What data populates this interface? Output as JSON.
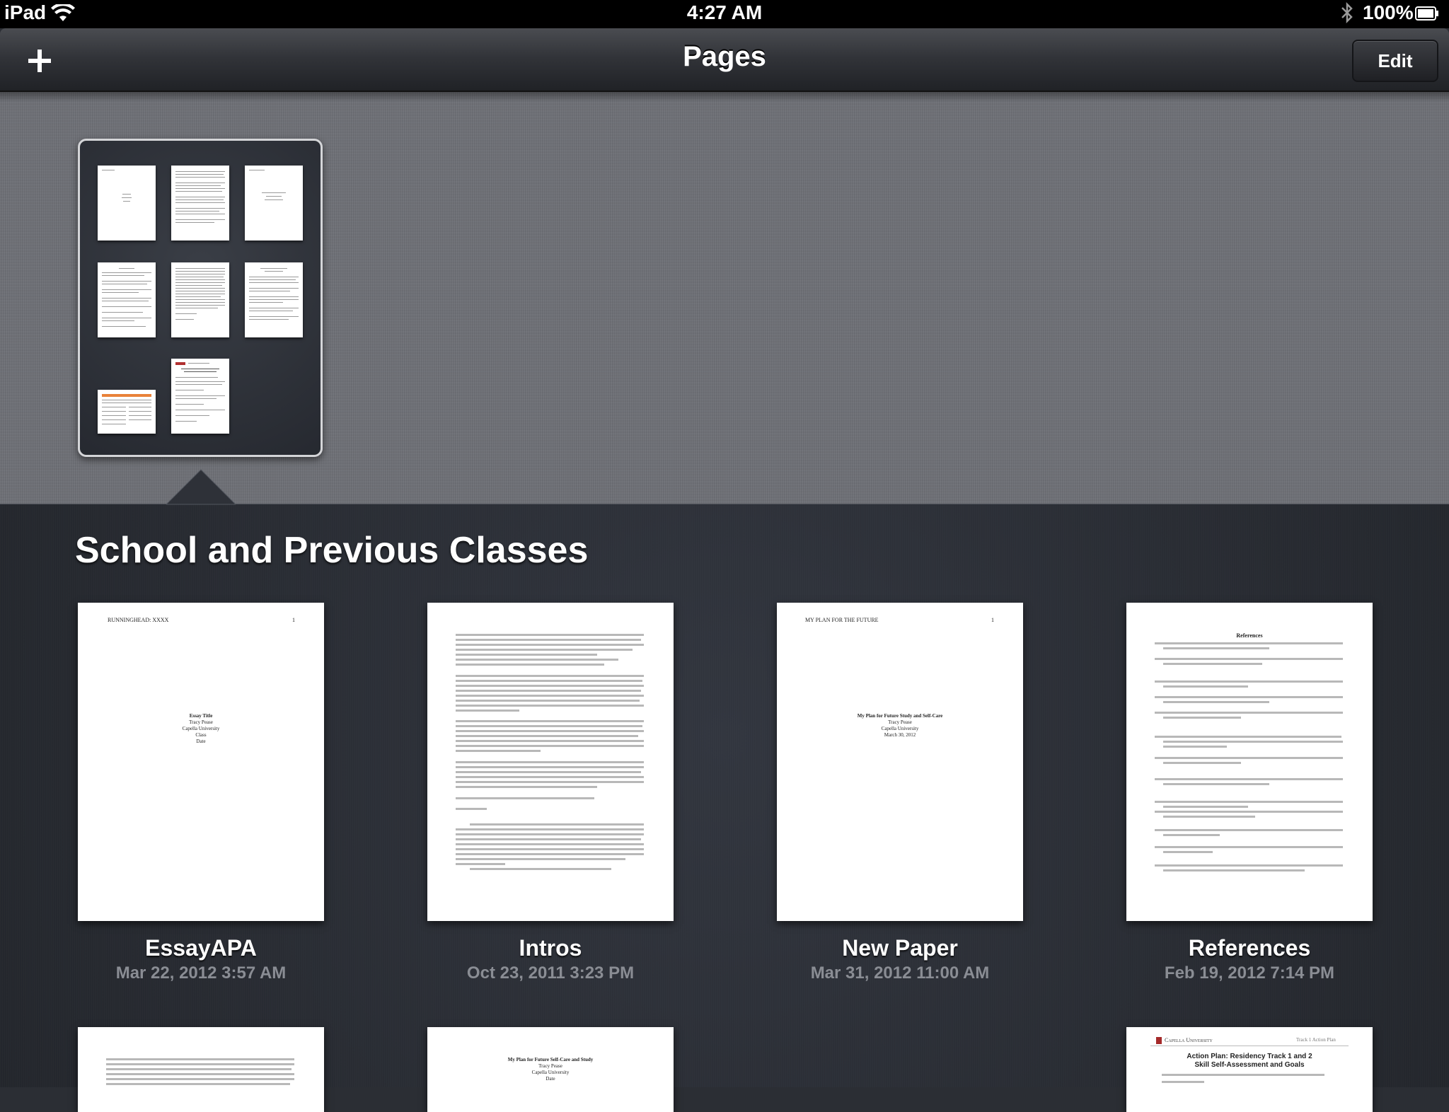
{
  "status_bar": {
    "device": "iPad",
    "time": "4:27 AM",
    "battery": "100%"
  },
  "nav": {
    "title": "Pages",
    "edit_label": "Edit"
  },
  "folder": {
    "title": "School and Previous Classes"
  },
  "documents": [
    {
      "name": "EssayAPA",
      "date": "Mar 22, 2012 3:57 AM",
      "header_left": "RUNNINGHEAD: XXXX",
      "header_right": "1",
      "title_lines": [
        "Essay Title",
        "Tracy Pease",
        "Capella University",
        "Class",
        "Date"
      ]
    },
    {
      "name": "Intros",
      "date": "Oct 23, 2011 3:23 PM"
    },
    {
      "name": "New Paper",
      "date": "Mar 31, 2012 11:00 AM",
      "header_left": "MY PLAN FOR THE FUTURE",
      "header_right": "1",
      "title_lines": [
        "My Plan for Future Study and Self-Care",
        "Tracy Pease",
        "Capella University",
        "March 30, 2012"
      ]
    },
    {
      "name": "References",
      "date": "Feb 19, 2012 7:14 PM",
      "heading": "References"
    }
  ],
  "bottom_documents": [
    {
      "lines": []
    },
    {
      "title_lines": [
        "My Plan for Future Self-Care and Study",
        "Tracy Pease",
        "Capella University",
        "Date"
      ]
    },
    {
      "brand": "Capella University",
      "tag": "Track 1 Action Plan",
      "heading_1": "Action Plan: Residency Track 1 and 2",
      "heading_2": "Skill Self-Assessment and Goals"
    }
  ],
  "icons": {
    "wifi": "wifi-icon",
    "bluetooth": "bluetooth-icon",
    "battery": "battery-icon",
    "add": "plus-icon"
  }
}
